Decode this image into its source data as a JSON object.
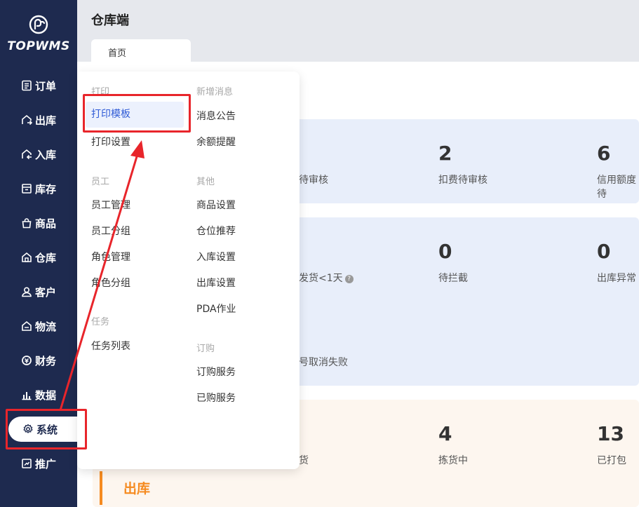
{
  "app": {
    "logo_text": "TOPWMS",
    "title": "仓库端"
  },
  "tabs": [
    {
      "label": "首页"
    }
  ],
  "sidebar": {
    "items": [
      {
        "label": "订单",
        "icon": "order-icon"
      },
      {
        "label": "出库",
        "icon": "outbound-icon"
      },
      {
        "label": "入库",
        "icon": "inbound-icon"
      },
      {
        "label": "库存",
        "icon": "inventory-icon"
      },
      {
        "label": "商品",
        "icon": "goods-icon"
      },
      {
        "label": "仓库",
        "icon": "warehouse-icon"
      },
      {
        "label": "客户",
        "icon": "customer-icon"
      },
      {
        "label": "物流",
        "icon": "logistics-icon"
      },
      {
        "label": "财务",
        "icon": "finance-icon"
      },
      {
        "label": "数据",
        "icon": "data-icon"
      },
      {
        "label": "系统",
        "icon": "gear-icon",
        "active": true
      },
      {
        "label": "推广",
        "icon": "promo-icon"
      }
    ]
  },
  "menu": {
    "col1": {
      "groups": [
        {
          "title": "打印",
          "items": [
            "打印模板",
            "打印设置"
          ]
        },
        {
          "title": "员工",
          "items": [
            "员工管理",
            "员工分组",
            "角色管理",
            "角色分组"
          ]
        },
        {
          "title": "任务",
          "items": [
            "任务列表"
          ]
        }
      ]
    },
    "col2": {
      "groups": [
        {
          "title": "新增消息",
          "items": [
            "消息公告",
            "余额提醒"
          ]
        },
        {
          "title": "其他",
          "items": [
            "商品设置",
            "仓位推荐",
            "入库设置",
            "出库设置",
            "PDA作业"
          ]
        },
        {
          "title": "订购",
          "items": [
            "订购服务",
            "已购服务"
          ]
        }
      ]
    },
    "selected": "打印模板"
  },
  "dashboard": {
    "row1": [
      {
        "value": "",
        "label": "待审核"
      },
      {
        "value": "2",
        "label": "扣费待审核"
      },
      {
        "value": "6",
        "label": "信用额度待"
      }
    ],
    "row2": [
      {
        "value": "",
        "label": "发货<1天"
      },
      {
        "value": "0",
        "label": "待拦截"
      },
      {
        "value": "0",
        "label": "出库异常"
      }
    ],
    "row2b": {
      "label": "号取消失败"
    },
    "row3": [
      {
        "value": "",
        "label": "货"
      },
      {
        "value": "4",
        "label": "拣货中"
      },
      {
        "value": "13",
        "label": "已打包"
      }
    ],
    "section_title": "出库"
  },
  "colors": {
    "sidebar": "#1e2a4f",
    "accent": "#2f5bd6",
    "annotation": "#e8252b",
    "orange": "#f58a1f"
  }
}
